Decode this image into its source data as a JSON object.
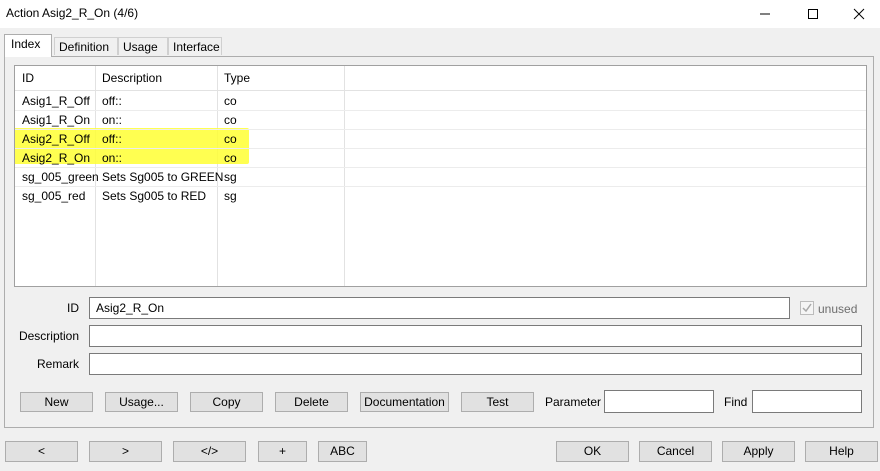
{
  "window": {
    "title": "Action Asig2_R_On (4/6)",
    "minimize_icon": "minimize-icon",
    "maximize_icon": "maximize-icon",
    "close_icon": "close-icon"
  },
  "tabs": [
    {
      "label": "Index",
      "active": true
    },
    {
      "label": "Definition"
    },
    {
      "label": "Usage"
    },
    {
      "label": "Interface"
    }
  ],
  "table": {
    "headers": [
      "ID",
      "Description",
      "Type"
    ],
    "rows": [
      {
        "id": "Asig1_R_Off",
        "description": "off::",
        "type": "co",
        "highlighted": false
      },
      {
        "id": "Asig1_R_On",
        "description": "on::",
        "type": "co",
        "highlighted": false
      },
      {
        "id": "Asig2_R_Off",
        "description": "off::",
        "type": "co",
        "highlighted": true
      },
      {
        "id": "Asig2_R_On",
        "description": "on::",
        "type": "co",
        "highlighted": true
      },
      {
        "id": "sg_005_green",
        "description": "Sets Sg005 to GREEN",
        "type": "sg",
        "highlighted": false
      },
      {
        "id": "sg_005_red",
        "description": "Sets Sg005 to RED",
        "type": "sg",
        "highlighted": false
      }
    ],
    "highlight_color": "#ffff33"
  },
  "form": {
    "id_label": "ID",
    "id_value": "Asig2_R_On",
    "unused_label": "unused",
    "unused_checked": true,
    "description_label": "Description",
    "description_value": "",
    "remark_label": "Remark",
    "remark_value": ""
  },
  "actions": {
    "new": "New",
    "usage": "Usage...",
    "copy": "Copy",
    "delete": "Delete",
    "documentation": "Documentation",
    "test": "Test",
    "parameter_label": "Parameter",
    "parameter_value": "",
    "find_label": "Find",
    "find_value": ""
  },
  "footer": {
    "prev": "<",
    "next": ">",
    "code": "</>",
    "plus": "+",
    "abc": "ABC",
    "ok": "OK",
    "cancel": "Cancel",
    "apply": "Apply",
    "help": "Help"
  }
}
